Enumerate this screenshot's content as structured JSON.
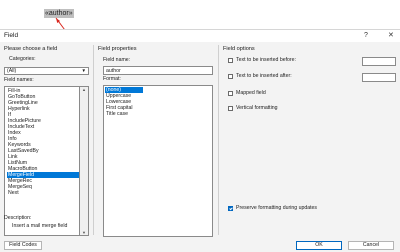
{
  "document": {
    "merge_field_text": "«author»"
  },
  "dialog": {
    "title": "Field",
    "help_label": "?",
    "close_label": "✕",
    "left": {
      "heading": "Please choose a field",
      "categories_label": "Categories:",
      "categories_value": "(All)",
      "field_names_label": "Field names:",
      "field_names": [
        "Fill-in",
        "GoToButton",
        "GreetingLine",
        "Hyperlink",
        "If",
        "IncludePicture",
        "IncludeText",
        "Index",
        "Info",
        "Keywords",
        "LastSavedBy",
        "Link",
        "ListNum",
        "MacroButton",
        "MergeField",
        "MergeRec",
        "MergeSeq",
        "Next"
      ],
      "selected_field": "MergeField"
    },
    "middle": {
      "heading": "Field properties",
      "field_name_label": "Field name:",
      "field_name_value": "author",
      "format_label": "Format:",
      "formats": [
        "(none)",
        "Uppercase",
        "Lowercase",
        "First capital",
        "Title case"
      ],
      "selected_format": "(none)"
    },
    "right": {
      "heading": "Field options",
      "text_before_label": "Text to be inserted before:",
      "text_after_label": "Text to be inserted after:",
      "mapped_field_label": "Mapped field",
      "vertical_formatting_label": "Vertical formatting",
      "preserve_formatting_label": "Preserve formatting during updates",
      "preserve_formatting_checked": true
    },
    "description": {
      "label": "Description:",
      "text": "Insert a mail merge field"
    },
    "buttons": {
      "field_codes": "Field Codes",
      "ok": "OK",
      "cancel": "Cancel"
    },
    "colors": {
      "selection": "#0078d7",
      "arrow": "#d9251d"
    }
  }
}
